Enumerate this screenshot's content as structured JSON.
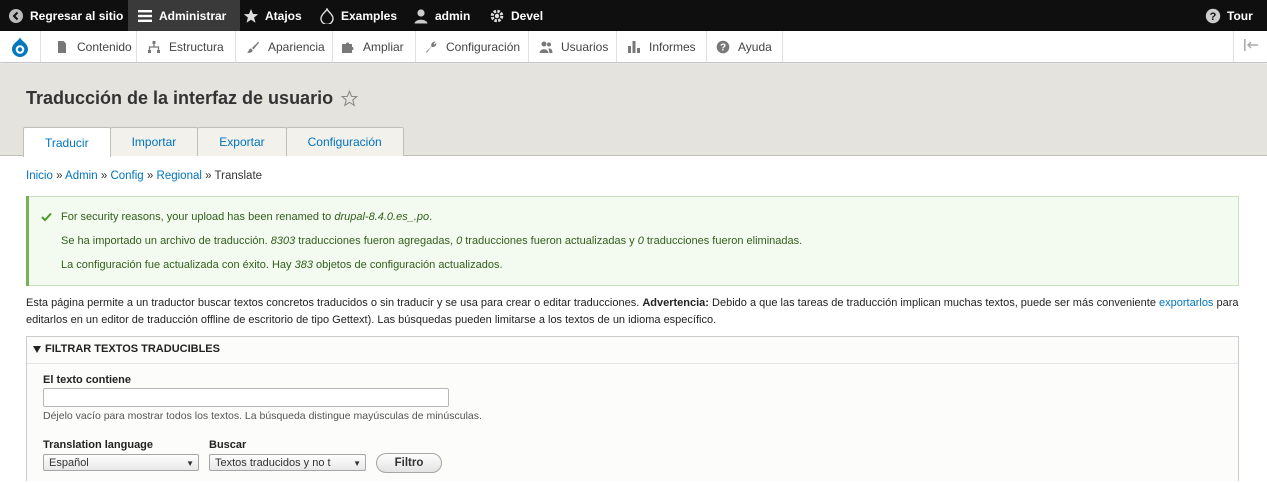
{
  "toolbar": {
    "back_label": "Regresar al sitio",
    "manage_label": "Administrar",
    "shortcuts_label": "Atajos",
    "examples_label": "Examples",
    "user_label": "admin",
    "devel_label": "Devel",
    "tour_label": "Tour"
  },
  "admin_menu": {
    "items": [
      {
        "label": "Contenido",
        "icon": "file-icon"
      },
      {
        "label": "Estructura",
        "icon": "sitemap-icon"
      },
      {
        "label": "Apariencia",
        "icon": "paintbrush-icon"
      },
      {
        "label": "Ampliar",
        "icon": "puzzle-icon"
      },
      {
        "label": "Configuración",
        "icon": "wrench-icon"
      },
      {
        "label": "Usuarios",
        "icon": "people-icon"
      },
      {
        "label": "Informes",
        "icon": "bar-chart-icon"
      },
      {
        "label": "Ayuda",
        "icon": "help-icon"
      }
    ]
  },
  "page": {
    "title": "Traducción de la interfaz de usuario"
  },
  "tabs": [
    {
      "label": "Traducir",
      "active": true
    },
    {
      "label": "Importar",
      "active": false
    },
    {
      "label": "Exportar",
      "active": false
    },
    {
      "label": "Configuración",
      "active": false
    }
  ],
  "breadcrumb": {
    "links": [
      "Inicio",
      "Admin",
      "Config",
      "Regional"
    ],
    "separator": "»",
    "current": "Translate"
  },
  "messages": {
    "line1_prefix": "For security reasons, your upload has been renamed to ",
    "line1_file": "drupal-8.4.0.es_.po",
    "line1_suffix": ".",
    "line2_a": "Se ha importado un archivo de traducción. ",
    "line2_added": "8303",
    "line2_b": " traducciones fueron agregadas, ",
    "line2_updated": "0",
    "line2_c": " traducciones fueron actualizadas y ",
    "line2_deleted": "0",
    "line2_d": " traducciones fueron eliminadas.",
    "line3_a": "La configuración fue actualizada con éxito. Hay ",
    "line3_count": "383",
    "line3_b": " objetos de configuración actualizados."
  },
  "intro": {
    "text_a": "Esta página permite a un traductor buscar textos concretos traducidos o sin traducir y se usa para crear o editar traducciones. ",
    "warning_label": "Advertencia:",
    "text_b": " Debido a que las tareas de traducción implican muchas textos, puede ser más conveniente ",
    "link": "exportarlos",
    "text_c": " para editarlos en un editor de traducción offline de escritorio de tipo Gettext). Las búsquedas pueden limitarse a los textos de un idioma específico."
  },
  "filter": {
    "legend": "FILTRAR TEXTOS TRADUCIBLES",
    "contains_label": "El texto contiene",
    "contains_value": "",
    "contains_description": "Déjelo vacío para mostrar todos los textos. La búsqueda distingue mayúsculas de minúsculas.",
    "language_label": "Translation language",
    "language_value": "Español",
    "search_label": "Buscar",
    "search_value": "Textos traducidos y no t",
    "submit_label": "Filtro"
  },
  "colors": {
    "toolbar_bg": "#0f0f0f",
    "link": "#0074bd",
    "header_bg": "#e4e3de",
    "status_bg": "#f3faef",
    "status_text": "#325e1c"
  }
}
